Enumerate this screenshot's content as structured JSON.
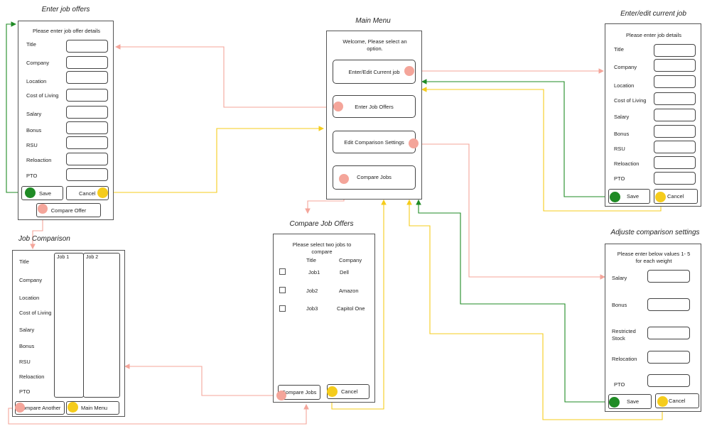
{
  "main_menu": {
    "title": "Main Menu",
    "prompt": "Welcome, Please select an option.",
    "buttons": [
      "Enter/Edit Current job",
      "Enter Job Offers",
      "Edit Comparison Settings",
      "Compare Jobs"
    ]
  },
  "enter_offers": {
    "title": "Enter job offers",
    "prompt": "Please enter job offer details",
    "fields": [
      "Title",
      "Company",
      "Location",
      "Cost of Living",
      "Salary",
      "Bonus",
      "RSU",
      "Reloaction",
      "PTO"
    ],
    "save": "Save",
    "cancel": "Cancel",
    "compare": "Compare Offer"
  },
  "current_job": {
    "title": "Enter/edit current job",
    "prompt": "Please enter job details",
    "fields": [
      "Title",
      "Company",
      "Location",
      "Cost of Living",
      "Salary",
      "Bonus",
      "RSU",
      "Reloaction",
      "PTO"
    ],
    "save": "Save",
    "cancel": "Cancel"
  },
  "comparison": {
    "title": "Job Comparison",
    "rows": [
      "Title",
      "Company",
      "Location",
      "Cost of Living",
      "Salary",
      "Bonus",
      "RSU",
      "Reloaction",
      "PTO"
    ],
    "col1": "Job 1",
    "col2": "Job 2",
    "compare_another": "Compare Another",
    "main_menu": "Main Menu"
  },
  "compare_offers": {
    "title": "Compare Job Offers",
    "prompt": "Please select two jobs to compare",
    "headers": [
      "Title",
      "Company"
    ],
    "rows": [
      {
        "title": "Job1",
        "company": "Dell"
      },
      {
        "title": "Job2",
        "company": "Amazon"
      },
      {
        "title": "Job3",
        "company": "Capitol One"
      }
    ],
    "compare": "Compare Jobs",
    "cancel": "Cancel"
  },
  "settings": {
    "title": "Adjuste comparison settings",
    "prompt": "Please enter below values 1- 5 for each weight",
    "fields": [
      "Salary",
      "Bonus",
      "Restricted Stock",
      "Relocation",
      "PTO"
    ],
    "save": "Save",
    "cancel": "Cancel"
  },
  "colors": {
    "pink": "#f4a59a",
    "yellow": "#f5cc1c",
    "green": "#1f8b25",
    "border": "#555555"
  }
}
